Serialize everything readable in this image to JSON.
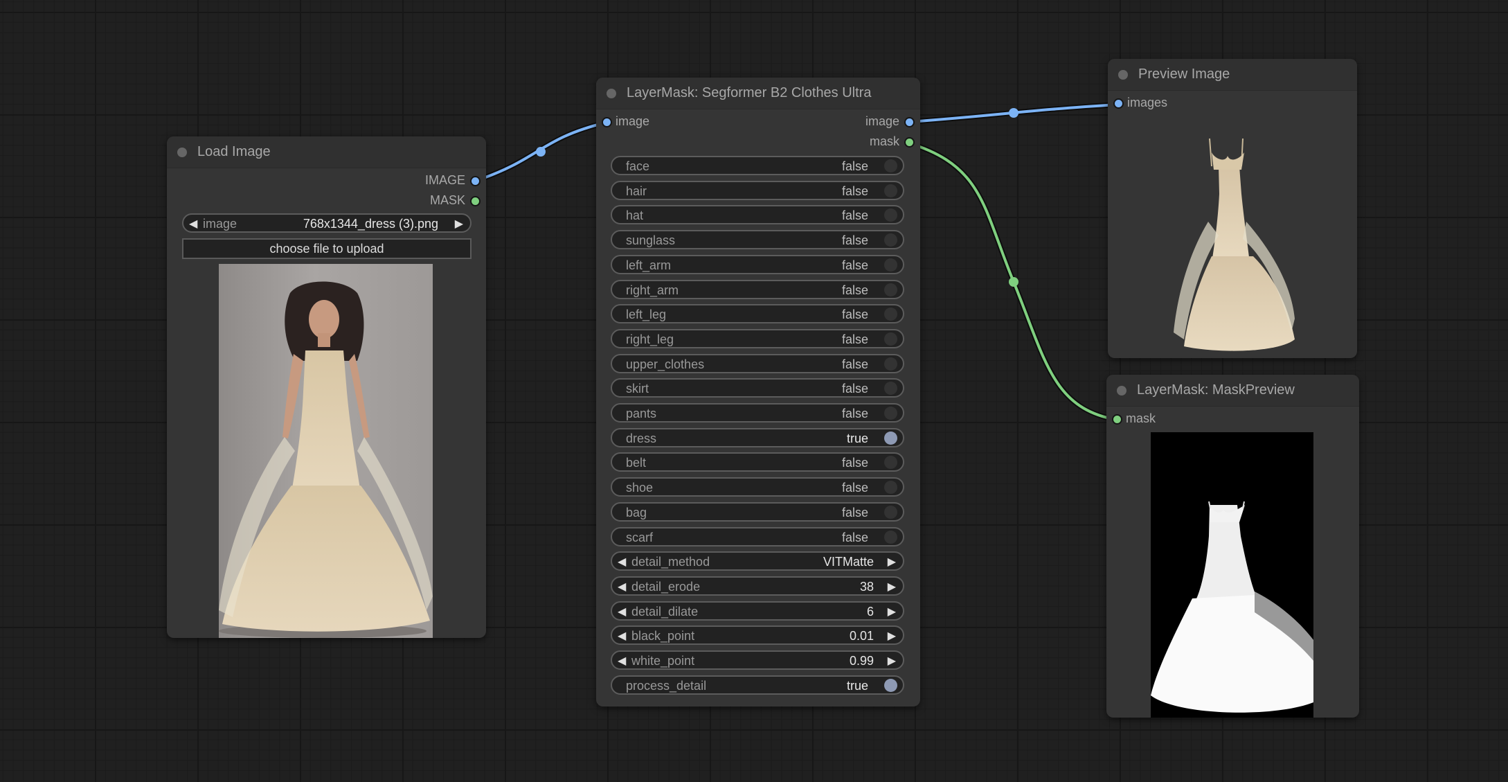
{
  "colors": {
    "image_link": "#7cb3f5",
    "mask_link": "#7fcf7f",
    "toggle_on": "#8e9ab4",
    "canvas_bg": "#202020",
    "node_bg": "#353535"
  },
  "nodes": {
    "load_image": {
      "title": "Load Image",
      "outputs": [
        "IMAGE",
        "MASK"
      ],
      "image_widget": {
        "label": "image",
        "value": "768x1344_dress (3).png"
      },
      "upload_label": "choose file to upload",
      "preview_description": "woman in beige lace gown"
    },
    "segformer": {
      "title": "LayerMask: Segformer B2 Clothes Ultra",
      "inputs": [
        "image"
      ],
      "outputs": [
        "image",
        "mask"
      ],
      "toggles": [
        {
          "label": "face",
          "value": "false",
          "on": false
        },
        {
          "label": "hair",
          "value": "false",
          "on": false
        },
        {
          "label": "hat",
          "value": "false",
          "on": false
        },
        {
          "label": "sunglass",
          "value": "false",
          "on": false
        },
        {
          "label": "left_arm",
          "value": "false",
          "on": false
        },
        {
          "label": "right_arm",
          "value": "false",
          "on": false
        },
        {
          "label": "left_leg",
          "value": "false",
          "on": false
        },
        {
          "label": "right_leg",
          "value": "false",
          "on": false
        },
        {
          "label": "upper_clothes",
          "value": "false",
          "on": false
        },
        {
          "label": "skirt",
          "value": "false",
          "on": false
        },
        {
          "label": "pants",
          "value": "false",
          "on": false
        },
        {
          "label": "dress",
          "value": "true",
          "on": true
        },
        {
          "label": "belt",
          "value": "false",
          "on": false
        },
        {
          "label": "shoe",
          "value": "false",
          "on": false
        },
        {
          "label": "bag",
          "value": "false",
          "on": false
        },
        {
          "label": "scarf",
          "value": "false",
          "on": false
        }
      ],
      "combos": [
        {
          "label": "detail_method",
          "value": "VITMatte"
        },
        {
          "label": "detail_erode",
          "value": "38"
        },
        {
          "label": "detail_dilate",
          "value": "6"
        },
        {
          "label": "black_point",
          "value": "0.01"
        },
        {
          "label": "white_point",
          "value": "0.99"
        }
      ],
      "process_detail": {
        "label": "process_detail",
        "value": "true",
        "on": true
      }
    },
    "preview_image": {
      "title": "Preview Image",
      "inputs": [
        "images"
      ],
      "preview_description": "segmented dress on transparent background"
    },
    "mask_preview": {
      "title": "LayerMask: MaskPreview",
      "inputs": [
        "mask"
      ],
      "preview_description": "white dress mask on black"
    }
  },
  "icons": {
    "arrow_left": "◀",
    "arrow_right": "▶"
  }
}
